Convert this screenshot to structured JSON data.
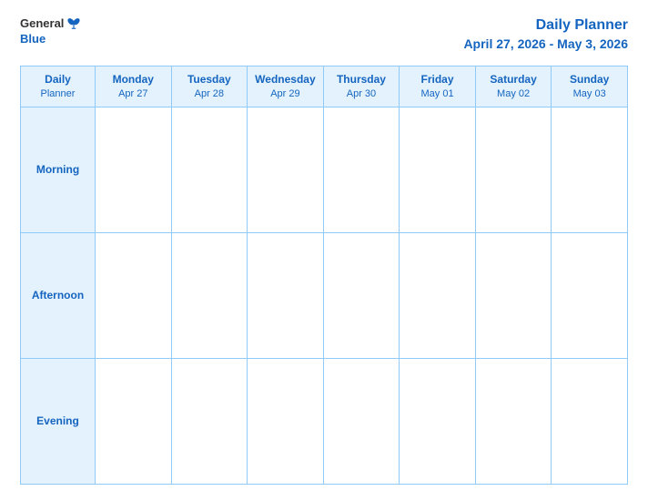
{
  "header": {
    "logo": {
      "general": "General",
      "blue": "Blue"
    },
    "title": "Daily Planner",
    "date_range": "April 27, 2026 - May 3, 2026"
  },
  "table": {
    "first_col_line1": "Daily",
    "first_col_line2": "Planner",
    "columns": [
      {
        "day": "Monday",
        "date": "Apr 27"
      },
      {
        "day": "Tuesday",
        "date": "Apr 28"
      },
      {
        "day": "Wednesday",
        "date": "Apr 29"
      },
      {
        "day": "Thursday",
        "date": "Apr 30"
      },
      {
        "day": "Friday",
        "date": "May 01"
      },
      {
        "day": "Saturday",
        "date": "May 02"
      },
      {
        "day": "Sunday",
        "date": "May 03"
      }
    ],
    "rows": [
      {
        "label": "Morning"
      },
      {
        "label": "Afternoon"
      },
      {
        "label": "Evening"
      }
    ]
  }
}
